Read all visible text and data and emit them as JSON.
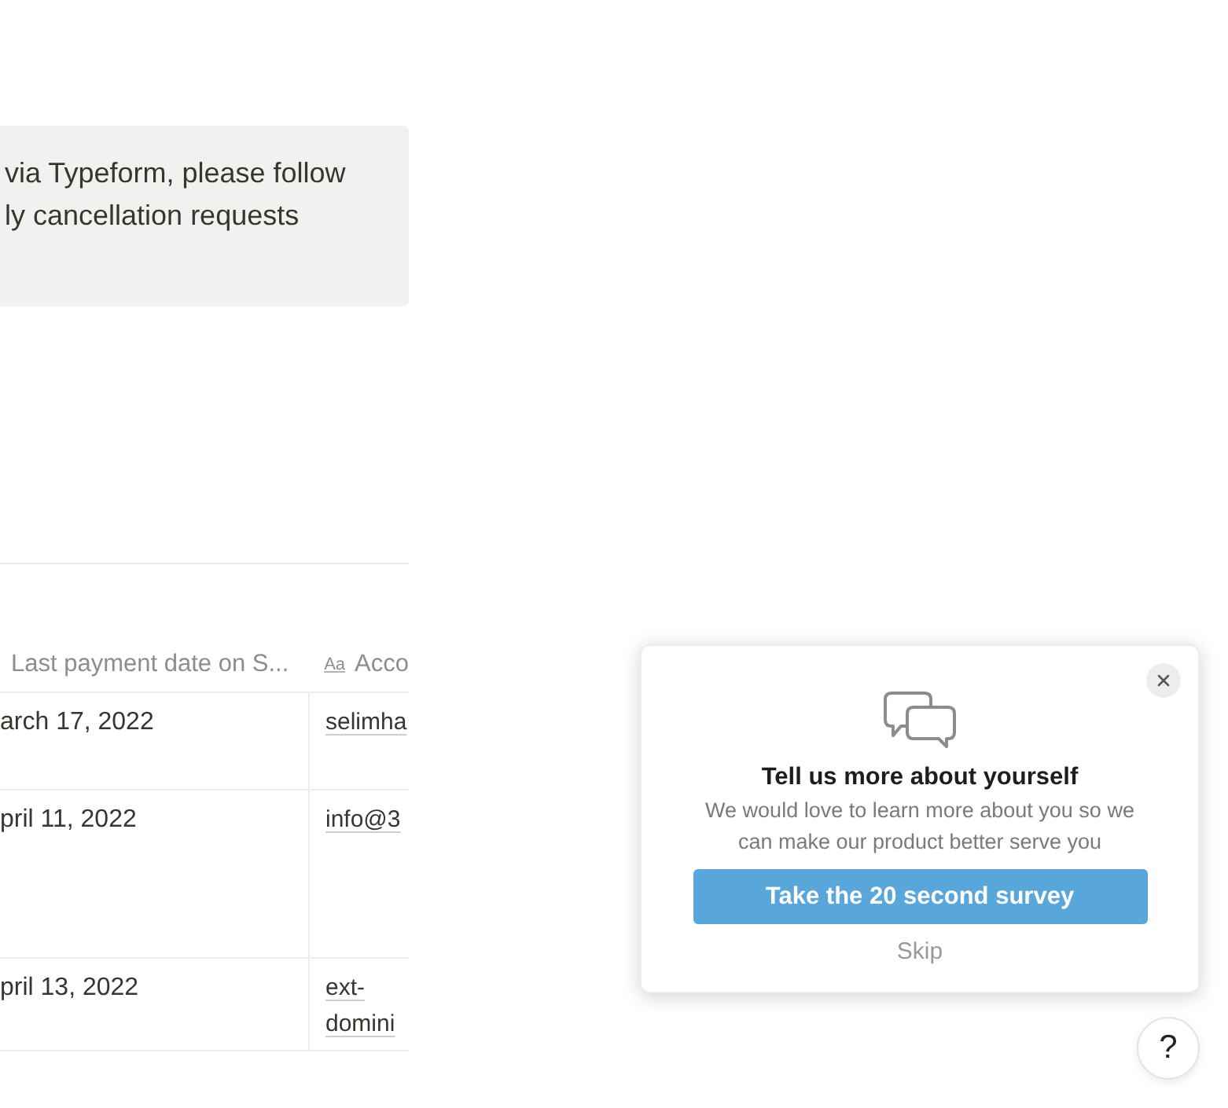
{
  "callout": {
    "lines": [
      "via Typeform, please follow",
      "ly cancellation requests"
    ]
  },
  "table": {
    "columns": [
      {
        "label": "Last payment date on S..."
      },
      {
        "icon_text": "Aa",
        "label": "Acco"
      }
    ],
    "rows": [
      [
        "arch 17, 2022",
        "selimha"
      ],
      [
        "pril 11, 2022",
        "info@3"
      ],
      [
        "pril 13, 2022",
        "ext-domini"
      ]
    ]
  },
  "survey_popup": {
    "title": "Tell us more about yourself",
    "body": "We would love to learn more about you so we can make our product better serve you",
    "button": "Take the 20 second survey",
    "skip": "Skip"
  },
  "help_button": {
    "label": "?"
  }
}
